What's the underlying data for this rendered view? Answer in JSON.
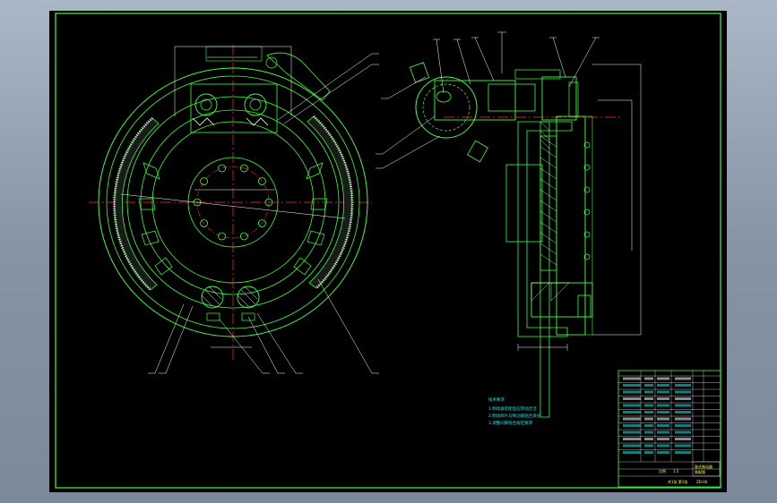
{
  "colors": {
    "background": "#000000",
    "frame": "#3cff3c",
    "centerline": "#ff2a2a",
    "dimension": "#ffffff",
    "leader": "#ffffff",
    "hatch": "#ffffff",
    "notes": "#22e5e5",
    "titleblock_text": "#ffff44"
  },
  "notes": {
    "heading": "技术要求",
    "lines": [
      "1.制动器装配后应转动灵活",
      "2.制动蹄片与制动鼓贴合良好",
      "3.调整间隙符合规定要求"
    ]
  },
  "title_block": {
    "drawing_title": "鼓式制动器",
    "subtitle": "装配图",
    "code": "ZD-00",
    "scale_label": "比例",
    "scale_value": "1:2",
    "sheet_label": "共1张 第1张"
  }
}
